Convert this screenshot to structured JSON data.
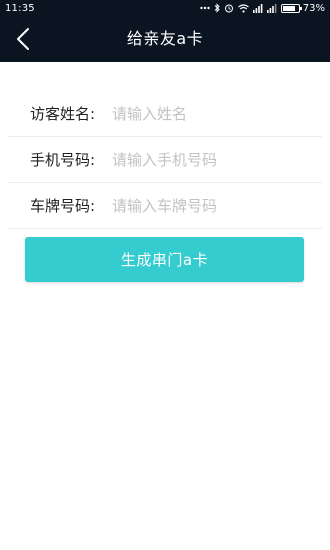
{
  "status_bar": {
    "time": "11:35",
    "battery": "73%",
    "icons": [
      "dots-icon",
      "bluetooth-icon",
      "alarm-icon",
      "wifi-icon",
      "signal-icon",
      "signal-icon",
      "battery-icon"
    ]
  },
  "nav": {
    "title": "给亲友a卡",
    "back_icon": "chevron-left-icon"
  },
  "form": {
    "fields": [
      {
        "label": "访客姓名:",
        "placeholder": "请输入姓名",
        "value": ""
      },
      {
        "label": "手机号码:",
        "placeholder": "请输入手机号码",
        "value": ""
      },
      {
        "label": "车牌号码:",
        "placeholder": "请输入车牌号码",
        "value": ""
      }
    ],
    "submit_label": "生成串门a卡"
  },
  "colors": {
    "header_bg": "#0b1421",
    "accent": "#34cccf",
    "placeholder": "#c2c2c2",
    "divider": "#e9eef1"
  }
}
